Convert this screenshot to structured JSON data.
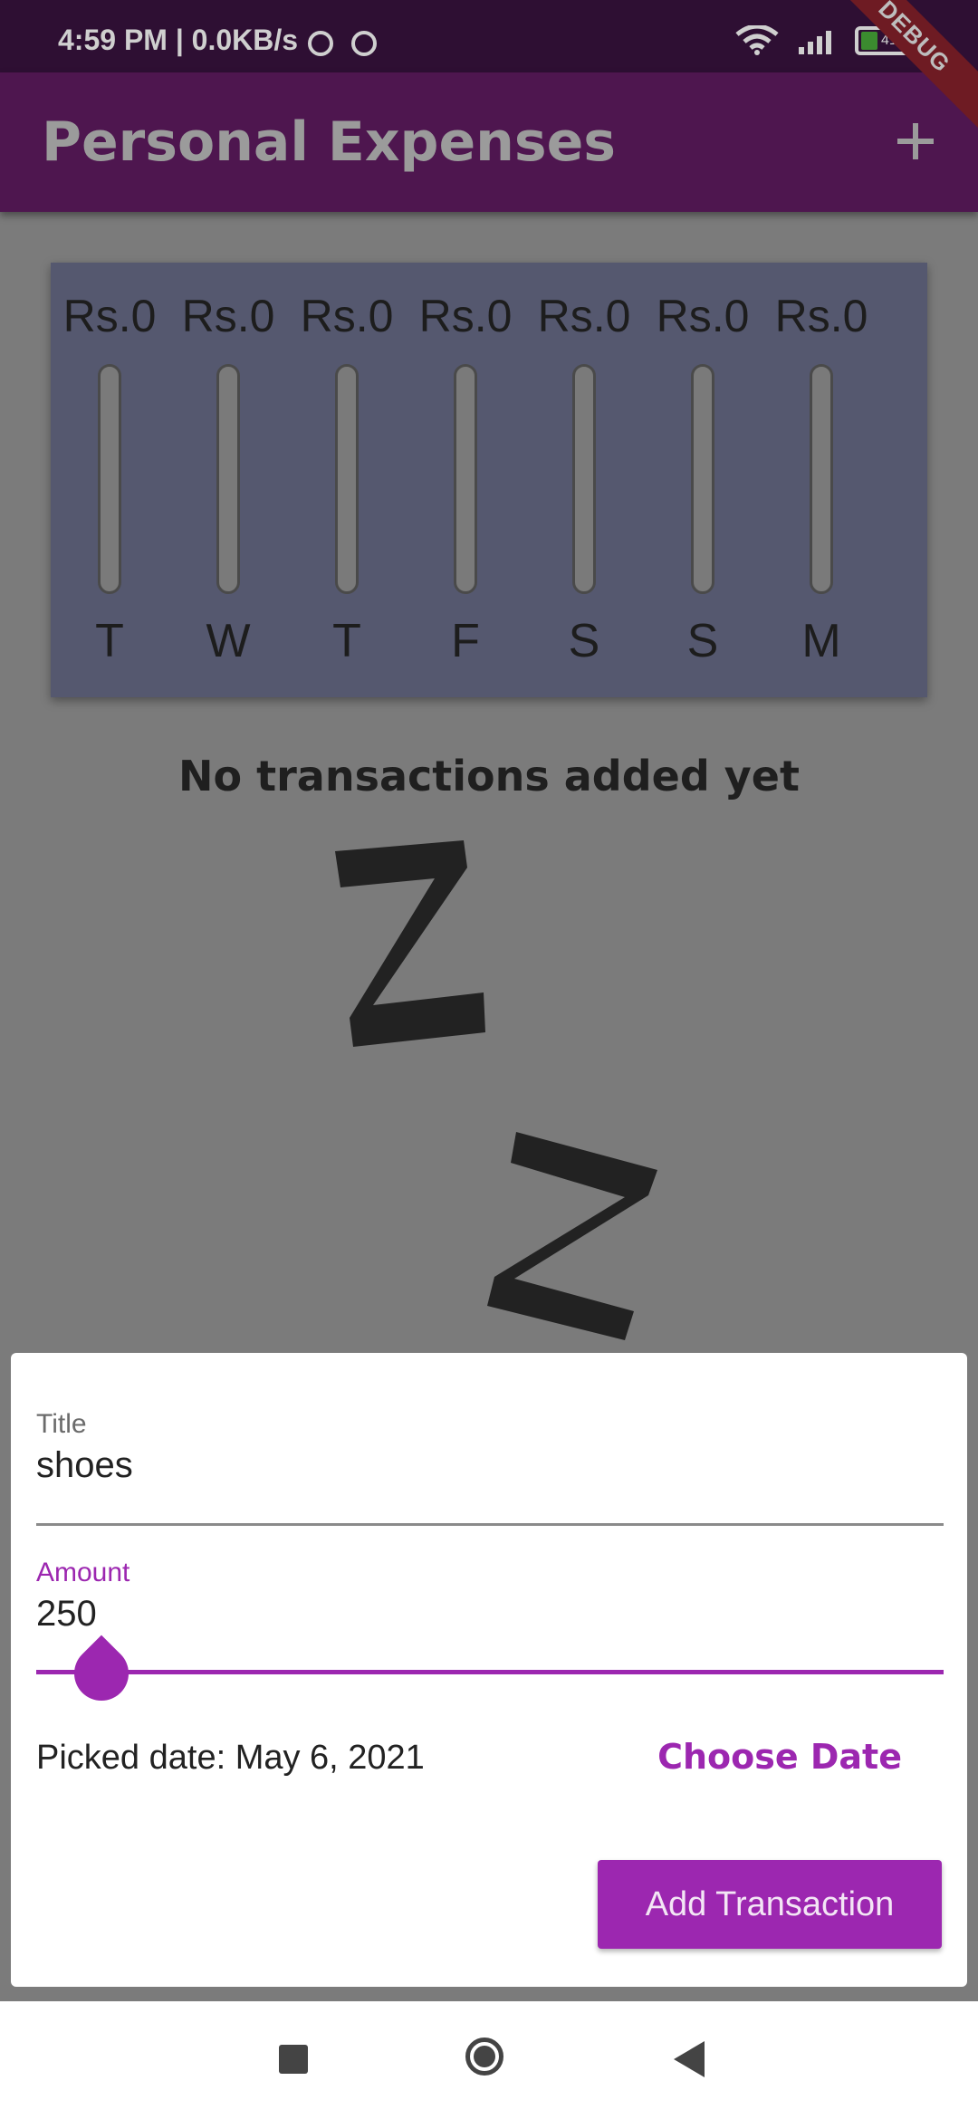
{
  "status_bar": {
    "time_network": "4:59 PM | 0.0KB/s",
    "battery_label": "41",
    "icons": [
      "wifi-icon",
      "signal-icon",
      "battery-icon"
    ]
  },
  "app_bar": {
    "title": "Personal Expenses",
    "add_icon": "add-icon",
    "debug_banner": "DEBUG"
  },
  "chart_data": {
    "type": "bar",
    "categories": [
      "T",
      "W",
      "T",
      "F",
      "S",
      "S",
      "M"
    ],
    "values": [
      0,
      0,
      0,
      0,
      0,
      0,
      0
    ],
    "labels": [
      "Rs.0",
      "Rs.0",
      "Rs.0",
      "Rs.0",
      "Rs.0",
      "Rs.0",
      "Rs.0"
    ],
    "title": "",
    "xlabel": "",
    "ylabel": "",
    "ylim": [
      0,
      1
    ]
  },
  "empty_state": {
    "message": "No transactions added yet",
    "image_icon": "sleeping-zz-icon"
  },
  "form": {
    "title_label": "Title",
    "title_value": "shoes",
    "amount_label": "Amount",
    "amount_value": "250",
    "picked_date_text": "Picked date: May 6, 2021",
    "choose_date_label": "Choose Date",
    "submit_label": "Add Transaction"
  },
  "nav_bar": {
    "icons": [
      "recent-apps-icon",
      "home-icon",
      "back-icon"
    ]
  },
  "colors": {
    "primary": "#9c27b0",
    "app_bar": "#4e164f",
    "chart_background": "#55586f"
  }
}
